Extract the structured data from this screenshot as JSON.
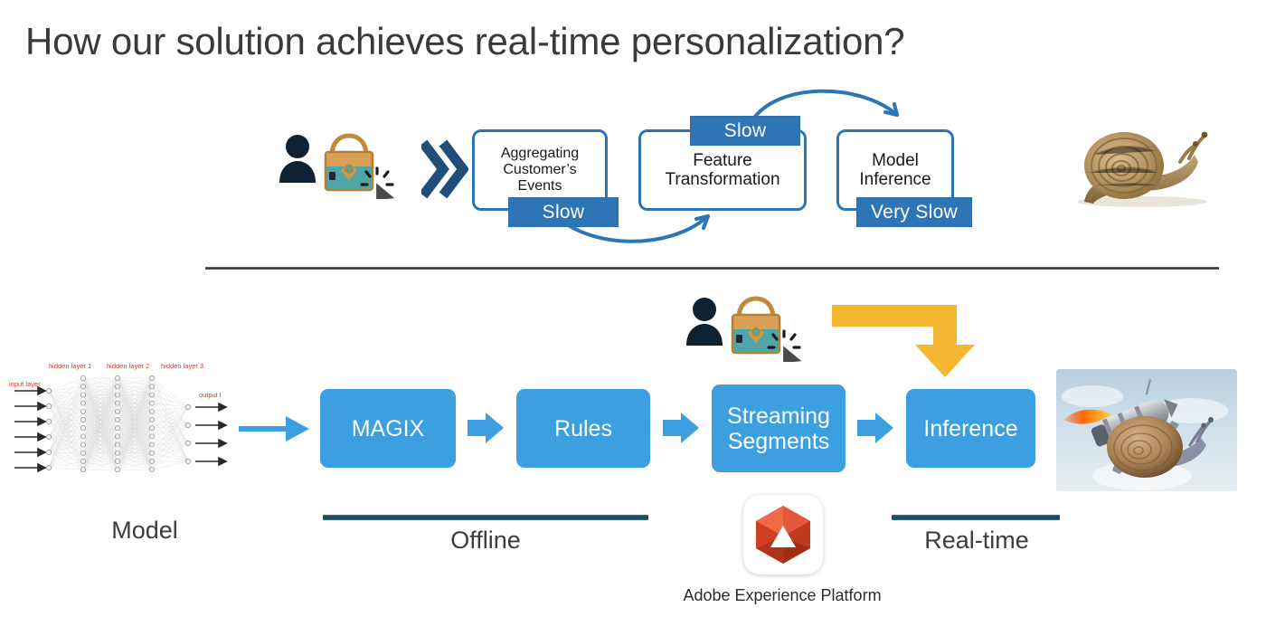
{
  "slide": {
    "title": "How our solution achieves real-time personalization?"
  },
  "legacy_flow": {
    "steps": [
      {
        "label": "Aggregating\nCustomer’s\nEvents",
        "badge": "Slow",
        "badge_position": "bottom"
      },
      {
        "label": "Feature\nTransformation",
        "badge": "Slow",
        "badge_position": "top"
      },
      {
        "label": "Model\nInference",
        "badge": "Very Slow",
        "badge_position": "bottom"
      }
    ],
    "step1_label": "Aggregating Customer’s Events",
    "step1_line1": "Aggregating",
    "step1_line2": "Customer’s",
    "step1_line3": "Events",
    "step2_line1": "Feature",
    "step2_line2": "Transformation",
    "step3_line1": "Model",
    "step3_line2": "Inference",
    "badge1": "Slow",
    "badge2": "Slow",
    "badge3": "Very Slow",
    "mascot": "snail-image",
    "user_icon": "person-icon",
    "product_icon": "handbag-icon",
    "click_icon": "cursor-click-icon",
    "chevron_icon": "double-chevron-icon"
  },
  "solution_flow": {
    "model_label": "Model",
    "model_diagram": {
      "input_layer": "input layer",
      "hidden_layer_1": "hidden layer 1",
      "hidden_layer_2": "hidden layer 2",
      "hidden_layer_3": "hidden layer 3",
      "output_layer": "output l"
    },
    "stages": [
      {
        "label": "MAGIX"
      },
      {
        "label": "Rules"
      },
      {
        "label": "Streaming Segments"
      },
      {
        "label": "Inference"
      }
    ],
    "stage1": "MAGIX",
    "stage2": "Rules",
    "stage3_line1": "Streaming",
    "stage3_line2": "Segments",
    "stage4": "Inference",
    "offline_label": "Offline",
    "realtime_label": "Real-time",
    "platform_label": "Adobe Experience Platform",
    "platform_logo": "adobe-experience-platform-logo",
    "mascot": "rocket-snail-image",
    "user_icon": "person-icon",
    "product_icon": "handbag-icon",
    "click_icon": "cursor-click-icon",
    "request_arrow": "yellow-elbow-arrow"
  },
  "colors": {
    "box_blue": "#3C9FE0",
    "badge_blue": "#2E75B6",
    "outline_blue": "#2E75B6",
    "segment_bar": "#1F4E64",
    "request_arrow": "#F5B731",
    "title_text": "#3A3A3A",
    "nn_label_red": "#E8302A",
    "person_navy": "#0E2233"
  }
}
